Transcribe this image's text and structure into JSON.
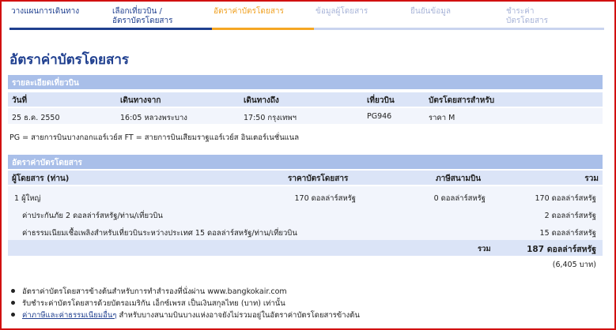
{
  "steps": [
    {
      "label": "วางแผนการเดินทาง",
      "label2": "",
      "state": "done"
    },
    {
      "label": "เลือกเที่ยวบิน /",
      "label2": "อัตราบัตรโดยสาร",
      "state": "done"
    },
    {
      "label": "อัตราค่าบัตรโดยสาร",
      "label2": "",
      "state": "active"
    },
    {
      "label": "ข้อมูลผู้โดยสาร",
      "label2": "",
      "state": "todo"
    },
    {
      "label": "ยืนยันข้อมูล",
      "label2": "",
      "state": "todo"
    },
    {
      "label": "ชำระค่า",
      "label2": "บัตรโดยสาร",
      "state": "todo"
    }
  ],
  "page_title": "อัตราค่าบัตรโดยสาร",
  "flight": {
    "section_title": "รายละเอียดเที่ยวบิน",
    "headers": [
      "วันที่",
      "เดินทางจาก",
      "เดินทางถึง",
      "เที่ยวบิน",
      "บัตรโดยสารสำหรับ"
    ],
    "row": [
      "25 ธ.ค. 2550",
      "16:05 หลวงพระบาง",
      "17:50 กรุงเทพฯ",
      "PG946",
      "ราคา M"
    ]
  },
  "airline_note": "PG = สายการบินบางกอกแอร์เวย์ส    FT = สายการบินเสียมราฐแอร์เวย์ส อินเตอร์เนชั่นแนล",
  "fare": {
    "section_title": "อัตราค่าบัตรโดยสาร",
    "headers": [
      "ผู้โดยสาร (ท่าน)",
      "ราคาบัตรโดยสาร",
      "ภาษีสนามบิน",
      "รวม"
    ],
    "passenger_row": [
      "1 ผู้ใหญ่",
      "170 ดอลล่าร์สหรัฐ",
      "0 ดอลล่าร์สหรัฐ",
      "170 ดอลล่าร์สหรัฐ"
    ],
    "insurance": [
      "ค่าประกันภัย 2 ดอลล่าร์สหรัฐ/ท่าน/เที่ยวบิน",
      "2 ดอลล่าร์สหรัฐ"
    ],
    "fuel": [
      "ค่าธรรมเนียมเชื้อเพลิงสำหรับเที่ยวบินระหว่างประเทศ 15 ดอลล่าร์สหรัฐ/ท่าน/เที่ยวบิน",
      "15 ดอลล่าร์สหรัฐ"
    ],
    "total_label": "รวม",
    "total_value": "187 ดอลล่าร์สหรัฐ",
    "total_thb": "(6,405 บาท)"
  },
  "bullets": {
    "b1": "อัตราค่าบัตรโดยสารข้างต้นสำหรับการทำสำรองที่นั่งผ่าน www.bangkokair.com",
    "b2": "รับชำระค่าบัตรโดยสารด้วยบัตรอเมริกัน เอ็กซ์เพรส เป็นเงินสกุลไทย (บาท) เท่านั้น",
    "b3_link": "ค่าภาษีและค่าธรรมเนียมอื่นๆ",
    "b3_rest": " สำหรับบางสนามบินบางแห่งอาจยังไม่รวมอยู่ในอัตราค่าบัตรโดยสารข้างต้น"
  },
  "colors": {
    "frame": "#d11010",
    "primary": "#1f3f8f",
    "active": "#f5a623",
    "section": "#a9bfe9"
  }
}
